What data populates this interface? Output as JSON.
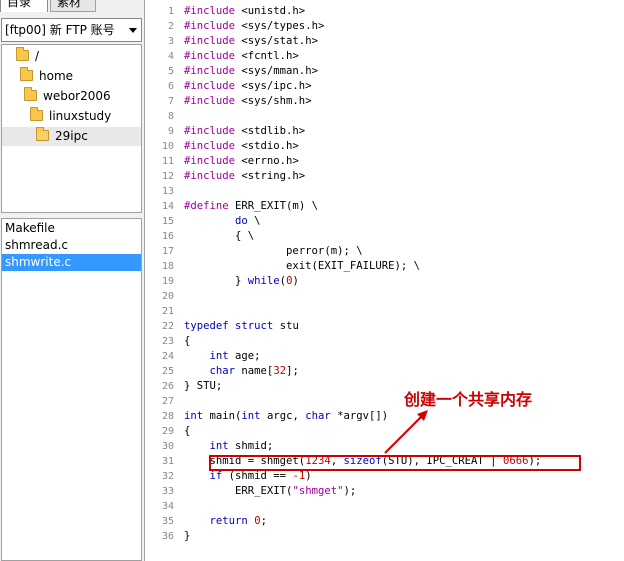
{
  "left_panel": {
    "tabs": [
      "目录",
      "素材"
    ],
    "account_select": "[ftp00] 新 FTP 账号",
    "tree": [
      {
        "label": "/",
        "icon": "folder-icon"
      },
      {
        "label": "home",
        "icon": "folder-icon"
      },
      {
        "label": "webor2006",
        "icon": "folder-icon"
      },
      {
        "label": "linuxstudy",
        "icon": "folder-icon"
      },
      {
        "label": "29ipc",
        "icon": "open-folder-icon",
        "selected": true
      }
    ],
    "files": [
      {
        "label": "Makefile"
      },
      {
        "label": "shmread.c"
      },
      {
        "label": "shmwrite.c",
        "selected": true
      }
    ]
  },
  "editor": {
    "lines": [
      {
        "n": "1",
        "text": "#include <unistd.h>"
      },
      {
        "n": "2",
        "text": "#include <sys/types.h>"
      },
      {
        "n": "3",
        "text": "#include <sys/stat.h>"
      },
      {
        "n": "4",
        "text": "#include <fcntl.h>"
      },
      {
        "n": "5",
        "text": "#include <sys/mman.h>"
      },
      {
        "n": "6",
        "text": "#include <sys/ipc.h>"
      },
      {
        "n": "7",
        "text": "#include <sys/shm.h>"
      },
      {
        "n": "8",
        "text": ""
      },
      {
        "n": "9",
        "text": "#include <stdlib.h>"
      },
      {
        "n": "10",
        "text": "#include <stdio.h>"
      },
      {
        "n": "11",
        "text": "#include <errno.h>"
      },
      {
        "n": "12",
        "text": "#include <string.h>"
      },
      {
        "n": "13",
        "text": ""
      },
      {
        "n": "14",
        "text": "#define ERR_EXIT(m) \\"
      },
      {
        "n": "15",
        "text": "        do \\"
      },
      {
        "n": "16",
        "text": "        { \\"
      },
      {
        "n": "17",
        "text": "                perror(m); \\"
      },
      {
        "n": "18",
        "text": "                exit(EXIT_FAILURE); \\"
      },
      {
        "n": "19",
        "text": "        } while(0)"
      },
      {
        "n": "20",
        "text": ""
      },
      {
        "n": "21",
        "text": ""
      },
      {
        "n": "22",
        "text": "typedef struct stu"
      },
      {
        "n": "23",
        "text": "{"
      },
      {
        "n": "24",
        "text": "    int age;"
      },
      {
        "n": "25",
        "text": "    char name[32];"
      },
      {
        "n": "26",
        "text": "} STU;"
      },
      {
        "n": "27",
        "text": ""
      },
      {
        "n": "28",
        "text": "int main(int argc, char *argv[])"
      },
      {
        "n": "29",
        "text": "{"
      },
      {
        "n": "30",
        "text": "    int shmid;"
      },
      {
        "n": "31",
        "text": "    shmid = shmget(1234, sizeof(STU), IPC_CREAT | 0666);"
      },
      {
        "n": "32",
        "text": "    if (shmid == -1)"
      },
      {
        "n": "33",
        "text": "        ERR_EXIT(\"shmget\");"
      },
      {
        "n": "34",
        "text": ""
      },
      {
        "n": "35",
        "text": "    return 0;"
      },
      {
        "n": "36",
        "text": "}"
      }
    ],
    "annotation": "创建一个共享内存"
  }
}
